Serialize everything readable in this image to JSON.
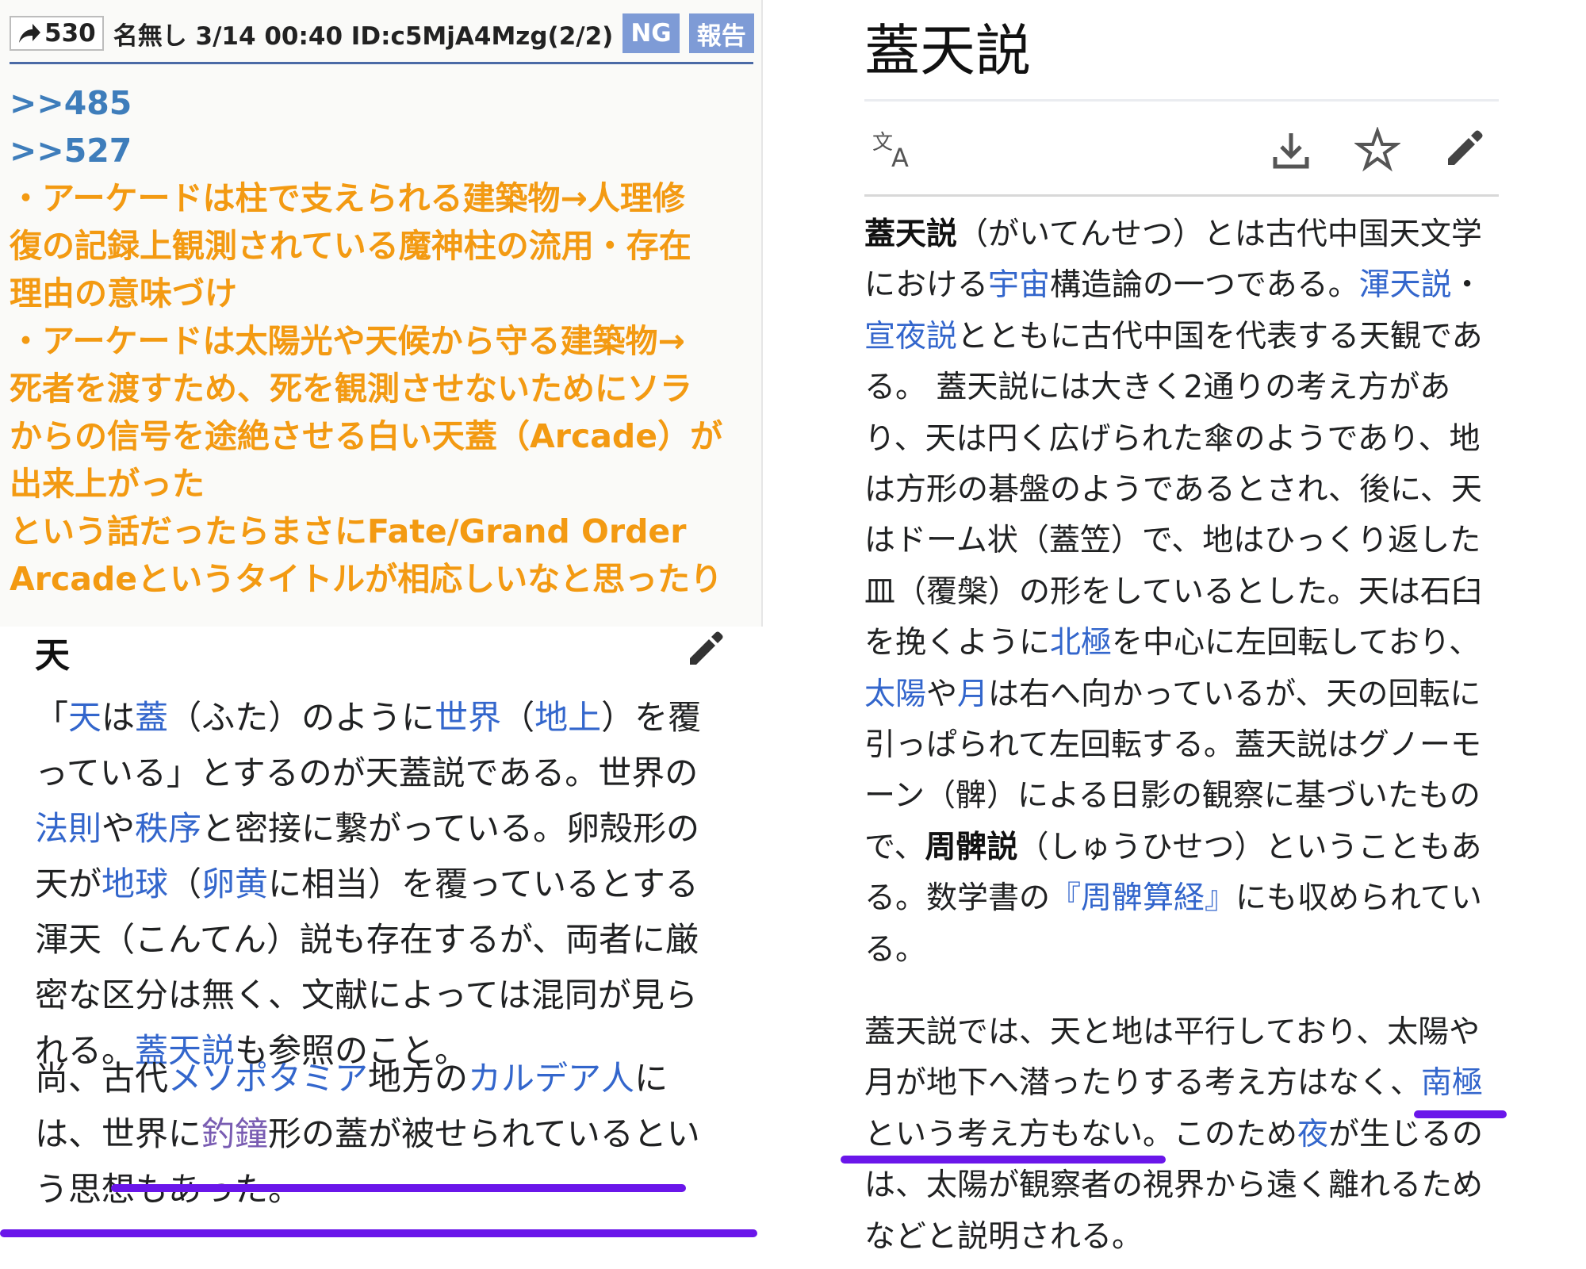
{
  "forum": {
    "res_number": "530",
    "header_text": "名無し 3/14 00:40 ID:c5MjA4Mzg(2/2)",
    "ng_label": "NG",
    "report_label": "報告",
    "anchors": [
      ">>485",
      ">>527"
    ],
    "lines": [
      "・アーケードは柱で支えられる建築物→人理修",
      "復の記録上観測されている魔神柱の流用・存在",
      "理由の意味づけ",
      "・アーケードは太陽光や天候から守る建築物→",
      "死者を渡すため、死を観測させないためにソラ",
      "からの信号を途絶させる白い天蓋（Arcade）が",
      "出来上がった",
      "という話だったらまさにFate/Grand Order",
      "Arcadeというタイトルが相応しいなと思ったり"
    ],
    "colors": {
      "anchor": "#3e7dbb",
      "body": "#f39a12",
      "button": "#7e9bd6"
    }
  },
  "wiki_left": {
    "heading_fragment": "天",
    "p1_lines": [
      [
        [
          "「",
          0
        ],
        [
          "天",
          1
        ],
        [
          "は",
          0
        ],
        [
          "蓋",
          1
        ],
        [
          "（ふた）のように",
          0
        ],
        [
          "世界",
          1
        ],
        [
          "（",
          0
        ],
        [
          "地上",
          1
        ],
        [
          "）を覆",
          0
        ]
      ],
      [
        [
          "っている」とするのが天蓋説である。世界の",
          0
        ]
      ],
      [
        [
          "法則",
          1
        ],
        [
          "や",
          0
        ],
        [
          "秩序",
          1
        ],
        [
          "と密接に繋がっている。卵殻形の",
          0
        ]
      ],
      [
        [
          "天が",
          0
        ],
        [
          "地球",
          1
        ],
        [
          "（",
          0
        ],
        [
          "卵黄",
          1
        ],
        [
          "に相当）を覆っているとする",
          0
        ]
      ],
      [
        [
          "渾天（こんてん）説も存在するが、両者に厳",
          0
        ]
      ],
      [
        [
          "密な区分は無く、文献によっては混同が見ら",
          0
        ]
      ],
      [
        [
          "れる。",
          0
        ],
        [
          "蓋天説",
          1
        ],
        [
          "も参照のこと。",
          0
        ]
      ]
    ],
    "p2_lines": [
      [
        [
          "尚、古代",
          0
        ],
        [
          "メソポタミア",
          1
        ],
        [
          "地方の",
          0
        ],
        [
          "カルデア人",
          1
        ],
        [
          "に",
          0
        ]
      ],
      [
        [
          "は、世界に",
          0
        ],
        [
          "釣鐘",
          2
        ],
        [
          "形の蓋が被せられているとい",
          0
        ]
      ],
      [
        [
          "う思想もあった。",
          0
        ]
      ]
    ]
  },
  "wiki_right": {
    "title": "蓋天説",
    "icons": [
      "translate-icon",
      "download-icon",
      "star-icon",
      "edit-icon"
    ],
    "p1_lines": [
      [
        [
          "蓋天説",
          3
        ],
        [
          "（がいてんせつ）とは古代中国天文学",
          0
        ]
      ],
      [
        [
          "における",
          0
        ],
        [
          "宇宙",
          1
        ],
        [
          "構造論の一つである。",
          0
        ],
        [
          "渾天説",
          1
        ],
        [
          "・",
          0
        ]
      ],
      [
        [
          "宣夜説",
          1
        ],
        [
          "とともに古代中国を代表する天観であ",
          0
        ]
      ],
      [
        [
          "る。 蓋天説には大きく2通りの考え方があ",
          0
        ]
      ],
      [
        [
          "り、天は円く広げられた傘のようであり、地",
          0
        ]
      ],
      [
        [
          "は方形の碁盤のようであるとされ、後に、天",
          0
        ]
      ],
      [
        [
          "はドーム状（蓋笠）で、地はひっくり返した",
          0
        ]
      ],
      [
        [
          "皿（覆槃）の形をしているとした。天は石臼",
          0
        ]
      ],
      [
        [
          "を挽くように",
          0
        ],
        [
          "北極",
          1
        ],
        [
          "を中心に左回転しており、",
          0
        ]
      ],
      [
        [
          "太陽",
          1
        ],
        [
          "や",
          0
        ],
        [
          "月",
          1
        ],
        [
          "は右へ向かっているが、天の回転に",
          0
        ]
      ],
      [
        [
          "引っぱられて左回転する。蓋天説はグノーモ",
          0
        ]
      ],
      [
        [
          "ーン（髀）による日影の観察に基づいたもの",
          0
        ]
      ],
      [
        [
          "で、",
          0
        ],
        [
          "周髀説",
          3
        ],
        [
          "（しゅうひせつ）ということもあ",
          0
        ]
      ],
      [
        [
          "る。数学書の",
          0
        ],
        [
          "『周髀算経』",
          1
        ],
        [
          "にも収められてい",
          0
        ]
      ],
      [
        [
          "る。",
          0
        ]
      ]
    ],
    "p2_lines": [
      [
        [
          "蓋天説では、天と地は平行しており、太陽や",
          0
        ]
      ],
      [
        [
          "月が地下へ潜ったりする考え方はなく、",
          0
        ],
        [
          "南極",
          1
        ]
      ],
      [
        [
          "という考え方もない。このため",
          0
        ],
        [
          "夜",
          1
        ],
        [
          "が生じるの",
          0
        ]
      ],
      [
        [
          "は、太陽が観察者の視界から遠く離れるため",
          0
        ]
      ],
      [
        [
          "などと説明される。",
          0
        ]
      ]
    ]
  },
  "annotation_color": "#6a16ea"
}
